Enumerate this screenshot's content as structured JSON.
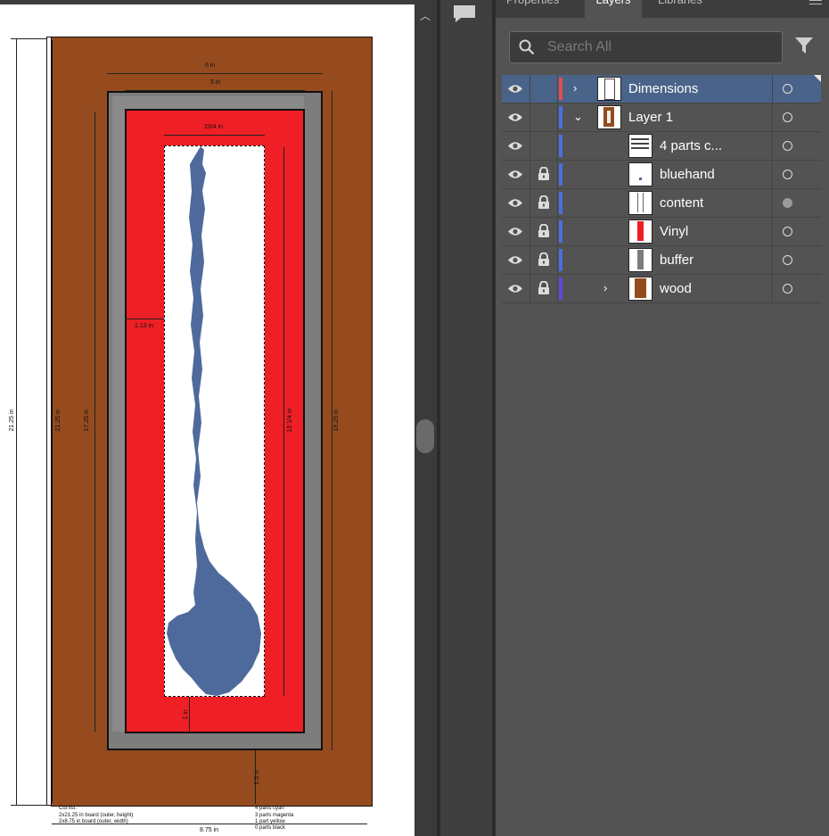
{
  "artboard": {
    "dimensions": {
      "top_outer": "6 in",
      "top_inner": "5 in",
      "red_width": "23/4 in",
      "board_height": "21.25 in",
      "total_height": "21.25 in",
      "inner_height": "17.25 in",
      "side_offset": "1.13 in",
      "content_height": "15 1/4 in",
      "buffer_height": "18.25 in",
      "bottom_gap": "1 in",
      "bottom_offset": "1.5 in",
      "bottom_width": "8.75 in"
    },
    "cut_list": [
      "Cut list:",
      "2x21.25 in board (outer, height)",
      "2x8.75 in board (outer, width)"
    ],
    "paint_mix": [
      "4 parts cyan",
      "3 parts magenta",
      "1 part yellow",
      "0 parts black"
    ],
    "colors": {
      "wood": "#954b1e",
      "buffer": "#7d7d7d",
      "vinyl": "#ee1f25",
      "hand": "#4e6a9c"
    }
  },
  "panel": {
    "tabs": [
      "Properties",
      "Layers",
      "Libraries"
    ],
    "search_placeholder": "Search All",
    "layers": [
      {
        "name": "Dimensions",
        "color": "#e84c4c",
        "selected": true,
        "expander": "›",
        "locked": false
      },
      {
        "name": "Layer 1",
        "color": "#4a6fe0",
        "selected": false,
        "expander": "⌄",
        "locked": false
      },
      {
        "name": "4 parts c...",
        "color": "#4a6fe0",
        "selected": false,
        "expander": "",
        "locked": false
      },
      {
        "name": "bluehand",
        "color": "#4a6fe0",
        "selected": false,
        "expander": "",
        "locked": true
      },
      {
        "name": "content",
        "color": "#4a6fe0",
        "selected": false,
        "expander": "",
        "locked": true
      },
      {
        "name": "Vinyl",
        "color": "#4a6fe0",
        "selected": false,
        "expander": "",
        "locked": true
      },
      {
        "name": "buffer",
        "color": "#4a6fe0",
        "selected": false,
        "expander": "",
        "locked": true
      },
      {
        "name": "wood",
        "color": "#5a4ae0",
        "selected": false,
        "expander": "›",
        "locked": true
      }
    ]
  }
}
